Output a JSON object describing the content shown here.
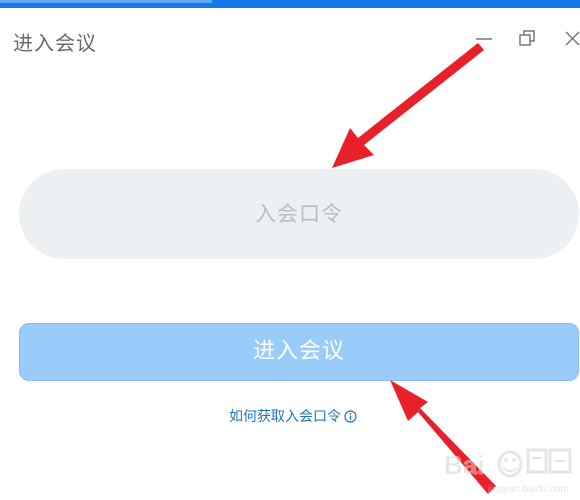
{
  "window": {
    "title": "进入会议",
    "controls": [
      "minimize-icon",
      "restore-icon",
      "close-icon"
    ]
  },
  "form": {
    "passcode_placeholder": "入会口令",
    "passcode_value": "",
    "join_button_label": "进入会议",
    "help_link_label": "如何获取入会口令",
    "help_icon": "info-icon"
  },
  "watermark": {
    "name": "baidu-jingyan-logo"
  },
  "colors": {
    "title_bar_accent": "#1677e6",
    "input_background": "#edf0f3",
    "button_background": "#99ccf9",
    "link_color": "#1f74c4",
    "annotation_arrow": "#e8202a"
  }
}
